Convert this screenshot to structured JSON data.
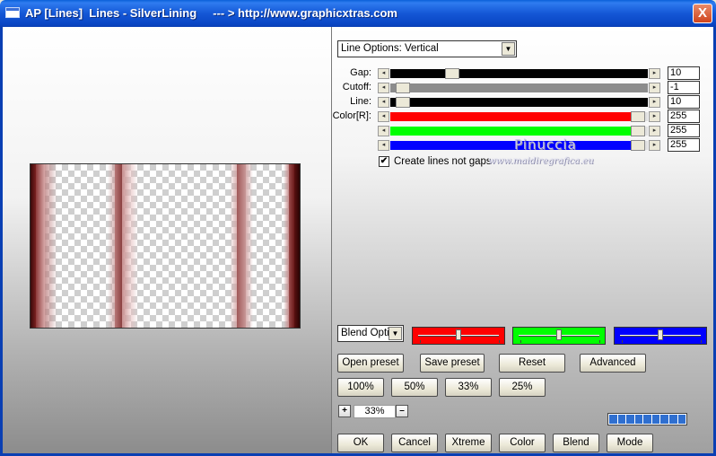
{
  "window": {
    "title": "AP [Lines]  Lines - SilverLining     --- > http://www.graphicxtras.com",
    "close_label": "X"
  },
  "line_options": {
    "selected": "Line Options: Vertical"
  },
  "sliders": [
    {
      "label": "Gap:",
      "value": "10",
      "fill_color": "#000000",
      "fill_fraction": 1.0,
      "thumb_fraction": 0.24
    },
    {
      "label": "Cutoff:",
      "value": "-1",
      "fill_color": "#8c8c8c",
      "fill_fraction": 1.0,
      "thumb_fraction": 0.05
    },
    {
      "label": "Line:",
      "value": "10",
      "fill_color": "#000000",
      "fill_fraction": 1.0,
      "thumb_fraction": 0.05
    },
    {
      "label": "Color[R]:",
      "value": "255",
      "fill_color": "#ff0000",
      "fill_fraction": 0.94,
      "thumb_fraction": 0.96
    },
    {
      "label": "",
      "value": "255",
      "fill_color": "#00ff00",
      "fill_fraction": 0.94,
      "thumb_fraction": 0.96
    },
    {
      "label": "",
      "value": "255",
      "fill_color": "#0000ff",
      "fill_fraction": 0.94,
      "thumb_fraction": 0.96
    }
  ],
  "checkbox": {
    "label": "Create lines not gaps",
    "checked": true,
    "mark": "✔"
  },
  "watermark": {
    "line1": "Pinuccia",
    "line2": "www.maidiregrafica.eu"
  },
  "blend": {
    "selected": "Blend Optio"
  },
  "color_boxes": [
    {
      "color": "#ff0000",
      "thumb_fraction": 0.5
    },
    {
      "color": "#00ff00",
      "thumb_fraction": 0.5
    },
    {
      "color": "#0000ff",
      "thumb_fraction": 0.5
    }
  ],
  "preset_buttons": {
    "open": "Open preset",
    "save": "Save preset",
    "reset": "Reset",
    "advanced": "Advanced"
  },
  "zoom_buttons": [
    "100%",
    "50%",
    "33%",
    "25%"
  ],
  "zoom": {
    "plus": "+",
    "value": "33%",
    "minus": "–"
  },
  "progress_segments": 9,
  "bottom_buttons": {
    "ok": "OK",
    "cancel": "Cancel",
    "xtreme": "Xtreme",
    "color": "Color",
    "blend": "Blend",
    "mode": "Mode"
  }
}
